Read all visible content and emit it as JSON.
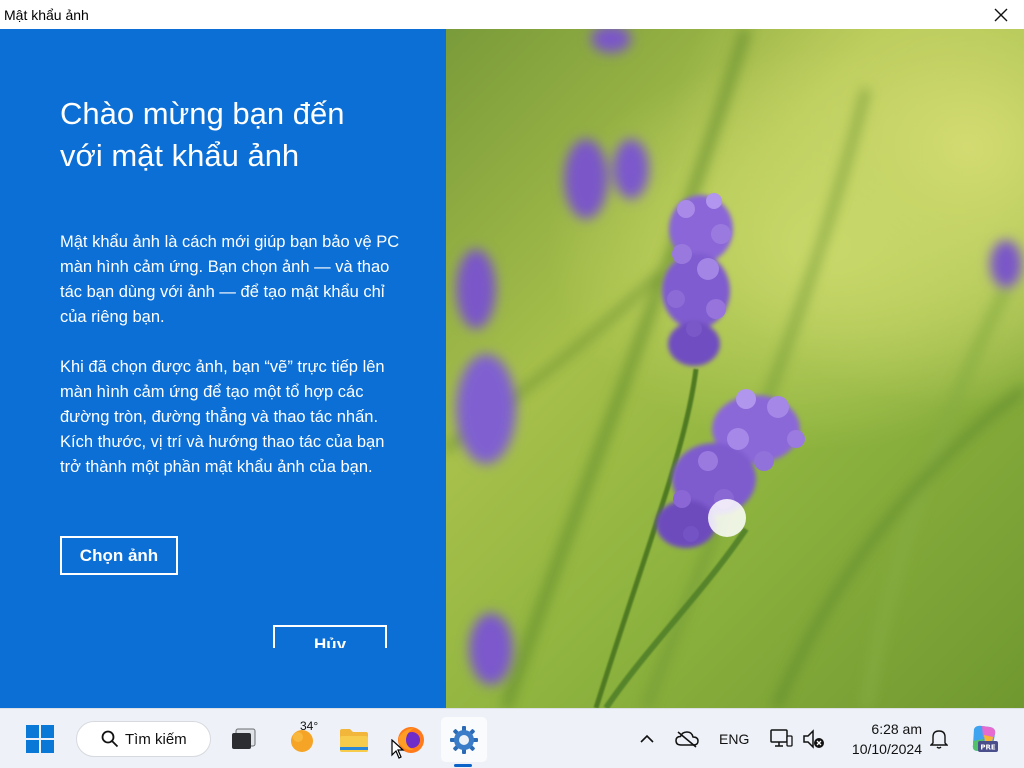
{
  "window": {
    "title": "Mật khẩu ảnh"
  },
  "panel": {
    "heading_line1": "Chào mừng bạn đến",
    "heading_line2": "với mật khẩu ảnh",
    "paragraph1": "Mật khẩu ảnh là cách mới giúp bạn bảo vệ PC màn hình cảm ứng. Bạn chọn ảnh — và thao tác bạn dùng với ảnh — để tạo mật khẩu chỉ của riêng bạn.",
    "paragraph2": "Khi đã chọn được ảnh, bạn “vẽ” trực tiếp lên màn hình cảm ứng để tạo một tổ hợp các đường tròn, đường thẳng và thao tác nhấn. Kích thước, vị trí và hướng thao tác của bạn trở thành một phần mật khẩu ảnh của bạn.",
    "choose_button": "Chọn ảnh",
    "cancel_button": "Hủy"
  },
  "taskbar": {
    "search_label": "Tìm kiếm",
    "weather_temp": "34°",
    "language": "ENG",
    "time": "6:28 am",
    "date": "10/10/2024",
    "copilot_badge": "PRE"
  },
  "colors": {
    "panel_blue": "#0b6fd6",
    "taskbar_bg": "#eef2f8",
    "accent": "#0b63c9"
  }
}
